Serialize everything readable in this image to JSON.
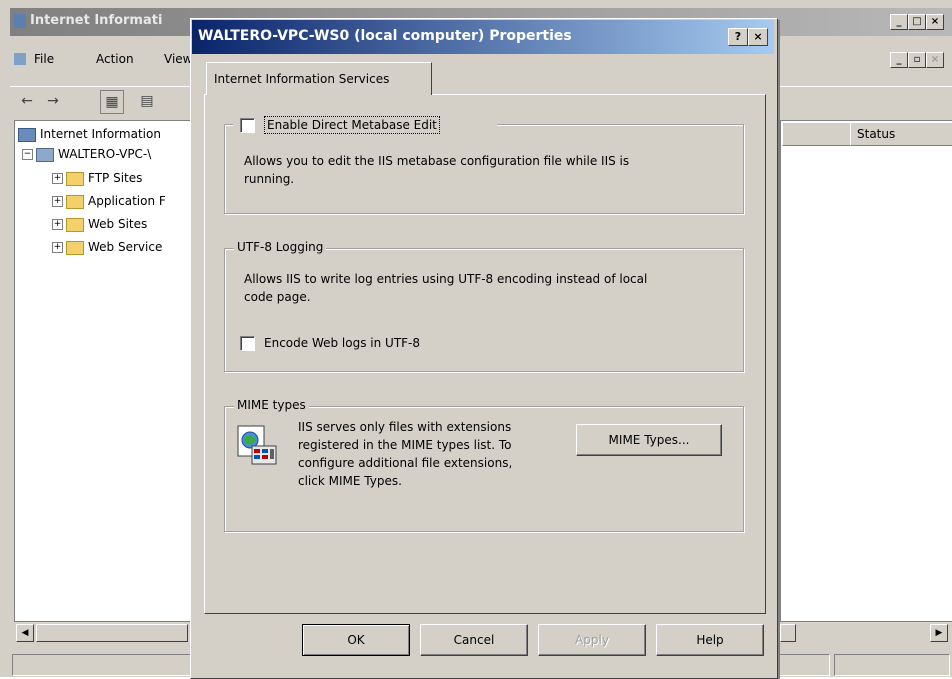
{
  "main_window": {
    "title": "Internet Informati",
    "menu": [
      "File",
      "Action",
      "View"
    ],
    "status_column": "Status",
    "tree": {
      "root": "Internet Information",
      "computer": "WALTERO-VPC-\\",
      "children": [
        "FTP Sites",
        "Application F",
        "Web Sites",
        "Web Service"
      ]
    }
  },
  "dialog": {
    "title": "WALTERO-VPC-WS0 (local computer) Properties",
    "help_glyph": "?",
    "close_glyph": "×",
    "tab_label": "Internet Information Services",
    "metabase": {
      "checkbox_label": "Enable Direct Metabase Edit",
      "description_line1": "Allows you to edit the IIS metabase configuration file while IIS is",
      "description_line2": "running."
    },
    "utf8": {
      "group_label": "UTF-8 Logging",
      "description_line1": "Allows IIS to write log entries using UTF-8 encoding instead of local",
      "description_line2": "code page.",
      "checkbox_label": "Encode Web logs in UTF-8"
    },
    "mime": {
      "group_label": "MIME types",
      "description_lines": [
        "IIS serves only files with extensions",
        "registered in the MIME types list. To",
        "configure additional file extensions,",
        "click MIME Types."
      ],
      "button_label": "MIME Types..."
    },
    "buttons": {
      "ok": "OK",
      "cancel": "Cancel",
      "apply": "Apply",
      "help": "Help"
    }
  },
  "colors": {
    "dialog_title_start": "#0a246a",
    "dialog_title_end": "#a6caf0",
    "window_face": "#d4d0c8"
  }
}
